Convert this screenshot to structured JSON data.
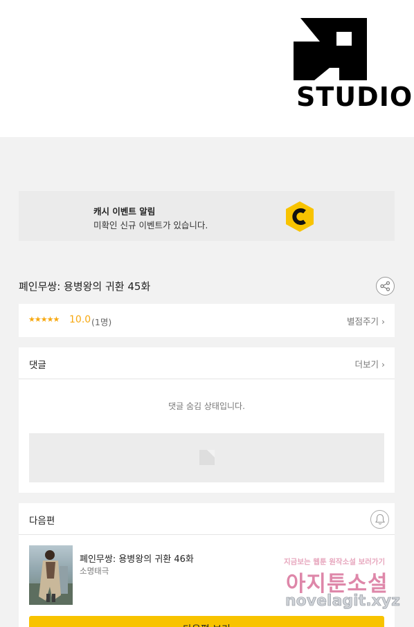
{
  "banner": {
    "logo_text": "STUDIO"
  },
  "cash_event": {
    "title": "캐시 이벤트 알림",
    "description": "미확인 신규 이벤트가 있습니다."
  },
  "episode": {
    "title": "폐인무쌍: 용병왕의 귀환 45화"
  },
  "rating": {
    "stars": "★★★★★",
    "score": "10.0",
    "count": "(1명)",
    "rate_link": "별점주기 ›"
  },
  "comments": {
    "label": "댓글",
    "more_link": "더보기 ›",
    "hidden_message": "댓글 숨김 상태입니다."
  },
  "next_episode": {
    "label": "다음편",
    "title": "폐인무쌍: 용병왕의 귀환 46화",
    "author": "소명태극",
    "button_label": "다음편 보기"
  },
  "watermark": {
    "top": "지금보는 웹툰 원작소설 보러가기",
    "middle": "아지툰소설",
    "bottom": "novelagit.xyz"
  },
  "colors": {
    "accent": "#f8c300",
    "star": "#f7a80f",
    "background": "#f2f2f2"
  }
}
